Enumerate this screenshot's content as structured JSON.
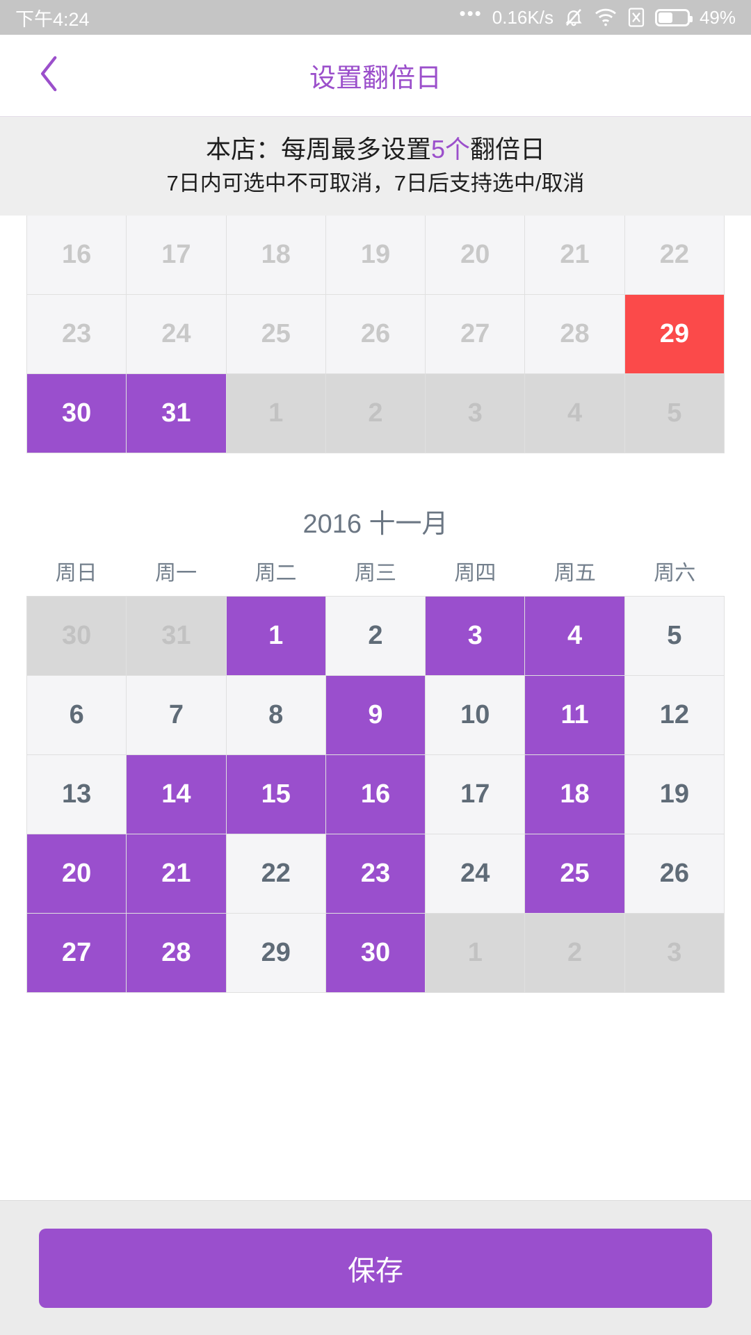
{
  "status_bar": {
    "time": "下午4:24",
    "overflow_icon": "•••",
    "network_speed": "0.16K/s",
    "mute_icon": "silent-bell",
    "wifi_icon": "wifi",
    "sim_icon": "sim-x",
    "battery_icon": "battery",
    "battery_percent": "49%"
  },
  "nav": {
    "back_icon": "chevron-left",
    "title": "设置翻倍日",
    "title_color": "#9b4fcb"
  },
  "notice": {
    "line1_before": "本店：每周最多设置",
    "line1_highlight": "5个",
    "line1_after": "翻倍日",
    "line2": "7日内可选中不可取消，7日后支持选中/取消",
    "highlight_color": "#9b4fcb"
  },
  "colors": {
    "selected": "#9a4fcd",
    "today": "#fb4a4a",
    "disabled_bg": "#d8d8d8",
    "cell_bg": "#f5f5f7"
  },
  "calendar_top": {
    "weeks": [
      [
        {
          "day": "16",
          "state": "muted"
        },
        {
          "day": "17",
          "state": "muted"
        },
        {
          "day": "18",
          "state": "muted"
        },
        {
          "day": "19",
          "state": "muted"
        },
        {
          "day": "20",
          "state": "muted"
        },
        {
          "day": "21",
          "state": "muted"
        },
        {
          "day": "22",
          "state": "muted"
        }
      ],
      [
        {
          "day": "23",
          "state": "muted"
        },
        {
          "day": "24",
          "state": "muted"
        },
        {
          "day": "25",
          "state": "muted"
        },
        {
          "day": "26",
          "state": "muted"
        },
        {
          "day": "27",
          "state": "muted"
        },
        {
          "day": "28",
          "state": "muted"
        },
        {
          "day": "29",
          "state": "today"
        }
      ],
      [
        {
          "day": "30",
          "state": "sel"
        },
        {
          "day": "31",
          "state": "sel"
        },
        {
          "day": "1",
          "state": "out"
        },
        {
          "day": "2",
          "state": "out"
        },
        {
          "day": "3",
          "state": "out"
        },
        {
          "day": "4",
          "state": "out"
        },
        {
          "day": "5",
          "state": "out"
        }
      ]
    ]
  },
  "calendar_november": {
    "month_title": "2016 十一月",
    "weekday_labels": [
      "周日",
      "周一",
      "周二",
      "周三",
      "周四",
      "周五",
      "周六"
    ],
    "weeks": [
      [
        {
          "day": "30",
          "state": "out"
        },
        {
          "day": "31",
          "state": "out"
        },
        {
          "day": "1",
          "state": "sel"
        },
        {
          "day": "2",
          "state": "normal"
        },
        {
          "day": "3",
          "state": "sel"
        },
        {
          "day": "4",
          "state": "sel"
        },
        {
          "day": "5",
          "state": "normal"
        }
      ],
      [
        {
          "day": "6",
          "state": "normal"
        },
        {
          "day": "7",
          "state": "normal"
        },
        {
          "day": "8",
          "state": "normal"
        },
        {
          "day": "9",
          "state": "sel"
        },
        {
          "day": "10",
          "state": "normal"
        },
        {
          "day": "11",
          "state": "sel"
        },
        {
          "day": "12",
          "state": "normal"
        }
      ],
      [
        {
          "day": "13",
          "state": "normal"
        },
        {
          "day": "14",
          "state": "sel"
        },
        {
          "day": "15",
          "state": "sel"
        },
        {
          "day": "16",
          "state": "sel"
        },
        {
          "day": "17",
          "state": "normal"
        },
        {
          "day": "18",
          "state": "sel"
        },
        {
          "day": "19",
          "state": "normal"
        }
      ],
      [
        {
          "day": "20",
          "state": "sel"
        },
        {
          "day": "21",
          "state": "sel"
        },
        {
          "day": "22",
          "state": "normal"
        },
        {
          "day": "23",
          "state": "sel"
        },
        {
          "day": "24",
          "state": "normal"
        },
        {
          "day": "25",
          "state": "sel"
        },
        {
          "day": "26",
          "state": "normal"
        }
      ],
      [
        {
          "day": "27",
          "state": "sel"
        },
        {
          "day": "28",
          "state": "sel"
        },
        {
          "day": "29",
          "state": "normal"
        },
        {
          "day": "30",
          "state": "sel"
        },
        {
          "day": "1",
          "state": "out"
        },
        {
          "day": "2",
          "state": "out"
        },
        {
          "day": "3",
          "state": "out"
        }
      ]
    ]
  },
  "footer": {
    "save_label": "保存"
  }
}
